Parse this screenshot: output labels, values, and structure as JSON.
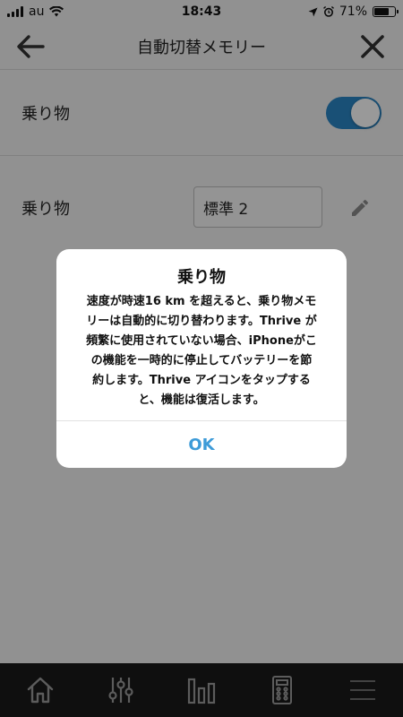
{
  "status_bar": {
    "carrier": "au",
    "time": "18:43",
    "battery": "71%",
    "battery_level": 0.71
  },
  "nav": {
    "title": "自動切替メモリー",
    "back_icon": "arrow-left-icon",
    "close_icon": "close-icon"
  },
  "settings": {
    "ride_toggle_label": "乗り物",
    "ride_toggle_on": true,
    "ride_mode_label": "乗り物",
    "ride_mode_value": "標準 2",
    "edit_icon": "pencil-icon"
  },
  "dialog": {
    "title": "乗り物",
    "message_lines": [
      "速度が時速16 km を超えると、乗り物メモ",
      "リーは自動的に切り替わります。Thrive が",
      "頻繁に使用されていない場合、iPhoneがこ",
      "の機能を一時的に停止してバッテリーを節",
      "約します。Thrive アイコンをタップする",
      "と、機能は復活します。"
    ],
    "ok_label": "OK"
  },
  "tab_bar": {
    "tabs": [
      "home-icon",
      "sliders-icon",
      "bar-chart-icon",
      "remote-icon",
      "menu-icon"
    ]
  },
  "colors": {
    "accent": "#2b86c5",
    "ok_text": "#3d9bd8",
    "tab_bar_bg": "#1a1a1a",
    "tab_icon": "#9a9a9a"
  }
}
